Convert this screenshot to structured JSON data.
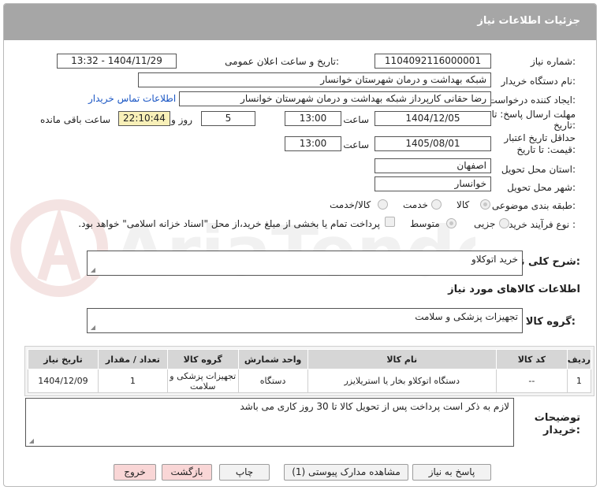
{
  "header": {
    "title": "جزئیات اطلاعات نیاز"
  },
  "need_number": {
    "label": "شماره نیاز:",
    "value": "1104092116000001"
  },
  "announce": {
    "label": "تاریخ و ساعت اعلان عمومی:",
    "value": "1404/11/29 - 13:32"
  },
  "buyer_org": {
    "label": "نام دستگاه خریدار:",
    "value": "شبکه بهداشت و درمان شهرستان خوانسار"
  },
  "requester": {
    "label": "ایجاد کننده درخواست:",
    "value": "رضا حقانی کارپرداز شبکه بهداشت و درمان شهرستان خوانسار",
    "contact_link": "اطلاعات تماس خریدار"
  },
  "deadline": {
    "label_line1": "مهلت ارسال پاسخ: تا",
    "label_line2": "تاریخ:",
    "date": "1404/12/05",
    "time_label": "ساعت",
    "time": "13:00",
    "days": "5",
    "days_label": "روز و",
    "remaining": "22:10:44",
    "remaining_label": "ساعت باقی مانده"
  },
  "validity": {
    "label_line1": "حداقل تاریخ اعتبار",
    "label_line2": "قیمت: تا تاریخ:",
    "date": "1405/08/01",
    "time_label": "ساعت",
    "time": "13:00"
  },
  "province": {
    "label": "استان محل تحویل:",
    "value": "اصفهان"
  },
  "city": {
    "label": "شهر محل تحویل:",
    "value": "خوانسار"
  },
  "category": {
    "label": "طبقه بندی موضوعی:",
    "options": [
      "کالا",
      "خدمت",
      "کالا/خدمت"
    ],
    "selected": "کالا"
  },
  "process": {
    "label": "نوع فرآیند خرید :",
    "options": [
      "جزیی",
      "متوسط"
    ],
    "selected": "جزیی",
    "note": "پرداخت تمام یا بخشی از مبلغ خرید،از محل \"اسناد خزانه اسلامی\" خواهد بود."
  },
  "summary": {
    "label": "شرح کلی نیاز:",
    "value": "خرید اتوکلاو"
  },
  "goods_section": {
    "title": "اطلاعات کالاهای مورد نیاز"
  },
  "goods_group": {
    "label": "گروه کالا:",
    "value": "تجهیزات پزشکی و سلامت"
  },
  "table": {
    "headers": [
      "ردیف",
      "کد کالا",
      "نام کالا",
      "واحد شمارش",
      "گروه کالا",
      "تعداد / مقدار",
      "تاریخ نیاز"
    ],
    "rows": [
      [
        "1",
        "--",
        "دستگاه اتوکلاو بخار یا استریلایزر",
        "دستگاه",
        "تجهیزات پزشکی و سلامت",
        "1",
        "1404/12/09"
      ]
    ]
  },
  "buyer_notes": {
    "label_line1": "توضیحات",
    "label_line2": "خریدار:",
    "value": "لازم به ذکر است پرداخت پس از تحویل کالا تا 30 روز کاری می باشد"
  },
  "buttons": {
    "reply": "پاسخ به نیاز",
    "attachments": "مشاهده مدارک پیوستی (1)",
    "print": "چاپ",
    "back": "بازگشت",
    "exit": "خروج"
  },
  "watermark": "AriaTender.net"
}
